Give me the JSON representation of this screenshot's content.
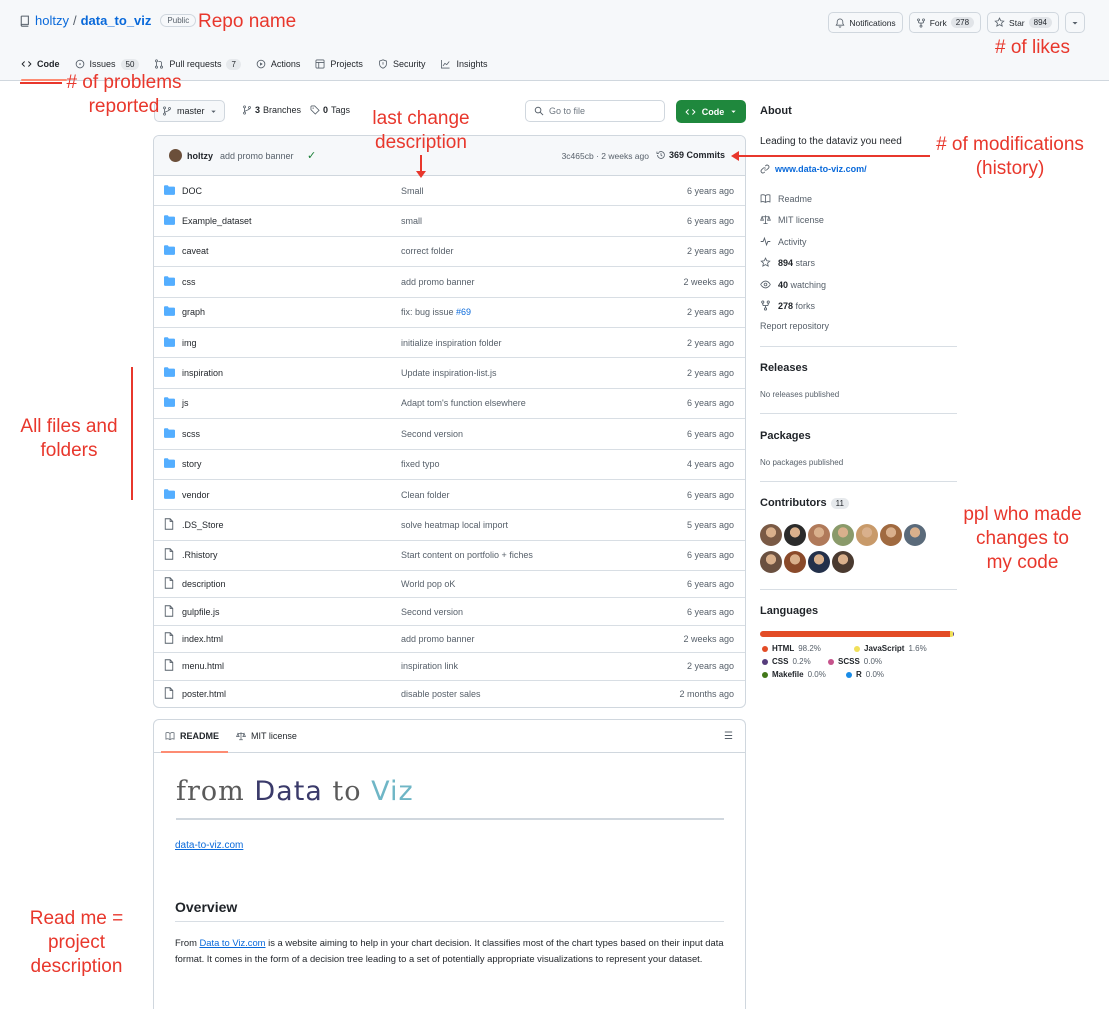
{
  "repo": {
    "owner": "holtzy",
    "separator": "/",
    "name": "data_to_viz",
    "visibility": "Public"
  },
  "header_buttons": {
    "notifications": "Notifications",
    "fork_label": "Fork",
    "fork_count": "278",
    "star_label": "Star",
    "star_count": "894"
  },
  "tabs": [
    {
      "label": "Code",
      "icon": "code-icon"
    },
    {
      "label": "Issues",
      "count": "50",
      "icon": "issue-icon"
    },
    {
      "label": "Pull requests",
      "count": "7",
      "icon": "pull-request-icon"
    },
    {
      "label": "Actions",
      "icon": "play-icon"
    },
    {
      "label": "Projects",
      "icon": "table-icon"
    },
    {
      "label": "Security",
      "icon": "shield-icon"
    },
    {
      "label": "Insights",
      "icon": "graph-icon"
    }
  ],
  "branch_bar": {
    "branch": "master",
    "branches_count": "3",
    "branches_label": "Branches",
    "tags_count": "0",
    "tags_label": "Tags",
    "goto_placeholder": "Go to file",
    "code_button": "Code"
  },
  "latest_commit": {
    "author": "holtzy",
    "message": "add promo banner",
    "sha_and_time": "3c465cb · 2 weeks ago",
    "commits": "369 Commits"
  },
  "files": [
    {
      "type": "folder",
      "name": "DOC",
      "message": "Small",
      "date": "6 years ago"
    },
    {
      "type": "folder",
      "name": "Example_dataset",
      "message": "small",
      "date": "6 years ago"
    },
    {
      "type": "folder",
      "name": "caveat",
      "message": "correct folder",
      "date": "2 years ago"
    },
    {
      "type": "folder",
      "name": "css",
      "message": "add promo banner",
      "date": "2 weeks ago"
    },
    {
      "type": "folder",
      "name": "graph",
      "message": "fix: bug issue ",
      "issue": "#69",
      "date": "2 years ago"
    },
    {
      "type": "folder",
      "name": "img",
      "message": "initialize inspiration folder",
      "date": "2 years ago"
    },
    {
      "type": "folder",
      "name": "inspiration",
      "message": "Update inspiration-list.js",
      "date": "2 years ago"
    },
    {
      "type": "folder",
      "name": "js",
      "message": "Adapt tom's function elsewhere",
      "date": "6 years ago"
    },
    {
      "type": "folder",
      "name": "scss",
      "message": "Second version",
      "date": "6 years ago"
    },
    {
      "type": "folder",
      "name": "story",
      "message": "fixed typo",
      "date": "4 years ago"
    },
    {
      "type": "folder",
      "name": "vendor",
      "message": "Clean folder",
      "date": "6 years ago"
    },
    {
      "type": "file",
      "name": ".DS_Store",
      "message": "solve heatmap local import",
      "date": "5 years ago"
    },
    {
      "type": "file",
      "name": ".Rhistory",
      "message": "Start content on portfolio + fiches",
      "date": "6 years ago"
    },
    {
      "type": "file",
      "name": "description",
      "message": "World pop oK",
      "date": "6 years ago"
    },
    {
      "type": "file",
      "name": "gulpfile.js",
      "message": "Second version",
      "date": "6 years ago"
    },
    {
      "type": "file",
      "name": "index.html",
      "message": "add promo banner",
      "date": "2 weeks ago"
    },
    {
      "type": "file",
      "name": "menu.html",
      "message": "inspiration link",
      "date": "2 years ago"
    },
    {
      "type": "file",
      "name": "poster.html",
      "message": "disable poster sales",
      "date": "2 months ago"
    }
  ],
  "readme": {
    "tab_readme": "README",
    "tab_license": "MIT license",
    "logo_from": "from",
    "logo_data": "Data",
    "logo_to": "to",
    "logo_viz": "Viz",
    "site_link": "data-to-viz.com",
    "overview_heading": "Overview",
    "overview_prefix": "From ",
    "overview_link": "Data to Viz.com",
    "overview_text": " is a website aiming to help in your chart decision. It classifies most of the chart types based on their input data format. It comes in the form of a decision tree leading to a set of potentially appropriate visualizations to represent your dataset."
  },
  "sidebar": {
    "about_heading": "About",
    "description": "Leading to the dataviz you need",
    "website": "www.data-to-viz.com/",
    "readme": "Readme",
    "license": "MIT license",
    "activity": "Activity",
    "stars_count": "894",
    "stars_label": "stars",
    "watching_count": "40",
    "watching_label": "watching",
    "forks_count": "278",
    "forks_label": "forks",
    "report": "Report repository",
    "releases_heading": "Releases",
    "releases_text": "No releases published",
    "packages_heading": "Packages",
    "packages_text": "No packages published",
    "contributors_heading": "Contributors",
    "contributors_count": "11",
    "contributor_colors": [
      "#7a5a45",
      "#2b2b2b",
      "#b07a5a",
      "#8a9a6a",
      "#c89a6a",
      "#a06a40",
      "#5a6a7a",
      "#6a5040",
      "#8a4a2a",
      "#23304a",
      "#4a3a30"
    ],
    "languages_heading": "Languages",
    "languages": [
      {
        "name": "HTML",
        "percent": "98.2%",
        "share": 98.2,
        "color": "#e34c26"
      },
      {
        "name": "JavaScript",
        "percent": "1.6%",
        "share": 1.6,
        "color": "#f1e05a"
      },
      {
        "name": "CSS",
        "percent": "0.2%",
        "share": 0.2,
        "color": "#563d7c"
      },
      {
        "name": "SCSS",
        "percent": "0.0%",
        "share": 0.0,
        "color": "#c6538c"
      },
      {
        "name": "Makefile",
        "percent": "0.0%",
        "share": 0.0,
        "color": "#427819"
      },
      {
        "name": "R",
        "percent": "0.0%",
        "share": 0.0,
        "color": "#198ce7"
      }
    ]
  },
  "annotations": {
    "repo_name": "Repo name",
    "likes": "# of likes",
    "problems": "# of problems\nreported",
    "last_change": "last change\ndescription",
    "modifications": "# of modifications\n(history)",
    "all_files": "All files and\nfolders",
    "contributors": "ppl who made\nchanges to\nmy code",
    "readme": "Read me =\nproject\ndescription"
  },
  "colors": {
    "accent_green": "#1f883d",
    "link_blue": "#0969da",
    "annotation_red": "#e8372c",
    "tab_underline": "#fd8c73"
  }
}
